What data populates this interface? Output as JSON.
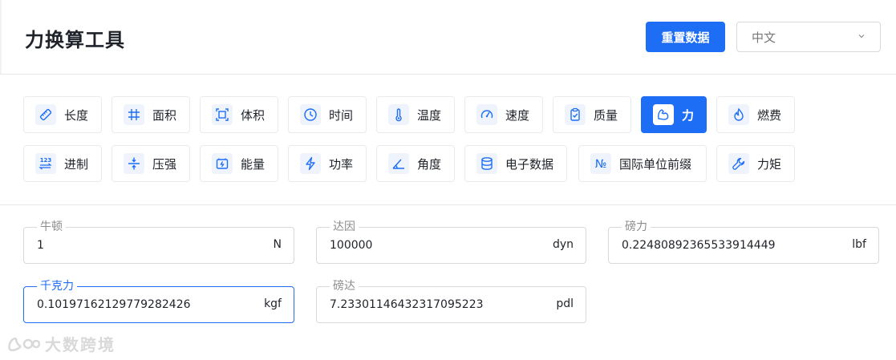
{
  "header": {
    "title": "力换算工具",
    "reset_label": "重置数据",
    "language": "中文"
  },
  "categories": [
    {
      "label": "长度",
      "icon": "ruler-icon"
    },
    {
      "label": "面积",
      "icon": "hash-icon"
    },
    {
      "label": "体积",
      "icon": "cube-frame-icon"
    },
    {
      "label": "时间",
      "icon": "clock-icon"
    },
    {
      "label": "温度",
      "icon": "thermometer-icon"
    },
    {
      "label": "速度",
      "icon": "speedometer-icon"
    },
    {
      "label": "质量",
      "icon": "clipboard-check-icon"
    },
    {
      "label": "力",
      "icon": "flexed-arm-icon",
      "active": true
    },
    {
      "label": "燃费",
      "icon": "flame-icon"
    },
    {
      "label": "进制",
      "icon": "numbers-123-icon"
    },
    {
      "label": "压强",
      "icon": "compress-icon"
    },
    {
      "label": "能量",
      "icon": "battery-charge-icon"
    },
    {
      "label": "功率",
      "icon": "lightning-icon"
    },
    {
      "label": "角度",
      "icon": "angle-icon"
    },
    {
      "label": "电子数据",
      "icon": "database-icon"
    },
    {
      "label": "国际单位前缀",
      "icon": "numero-sign-icon"
    },
    {
      "label": "力矩",
      "icon": "wrench-icon"
    }
  ],
  "fields": [
    {
      "label": "牛顿",
      "value": "1",
      "unit": "N"
    },
    {
      "label": "达因",
      "value": "100000",
      "unit": "dyn"
    },
    {
      "label": "磅力",
      "value": "0.22480892365533914449",
      "unit": "lbf"
    },
    {
      "label": "千克力",
      "value": "0.10197162129779282426",
      "unit": "kgf",
      "focused": true
    },
    {
      "label": "磅达",
      "value": "7.23301146432317095223",
      "unit": "pdl"
    }
  ],
  "watermark": "大数跨境",
  "colors": {
    "accent": "#1e6ef5",
    "icon_bg": "#eef3fc",
    "border": "#d9d9d9"
  }
}
